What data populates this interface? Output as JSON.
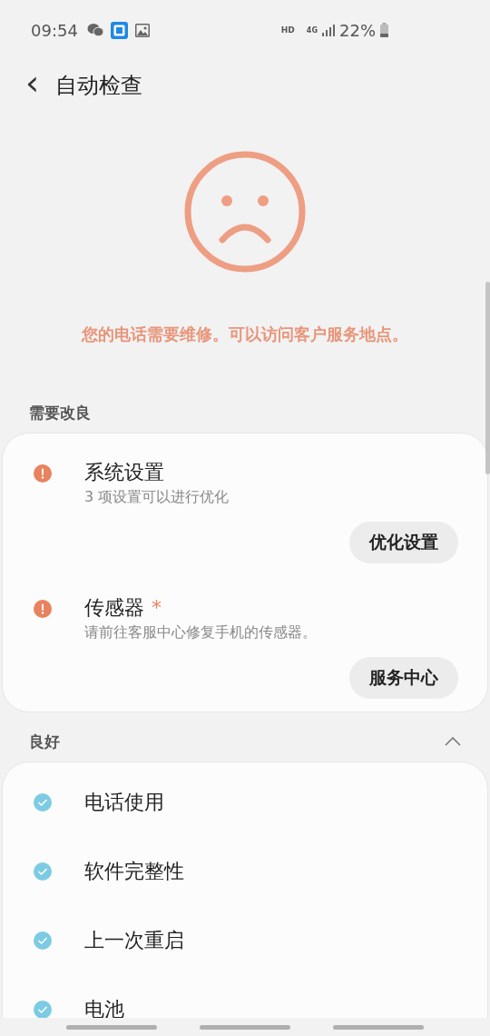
{
  "status_bar": {
    "time": "09:54",
    "hd": "HD",
    "network": "4G",
    "battery": "22%"
  },
  "header": {
    "back": "‹",
    "title": "自动检查"
  },
  "result": {
    "message": "您的电话需要维修。可以访问客户服务地点。"
  },
  "sections": [
    {
      "title": "需要改良",
      "items": [
        {
          "kind": "warning",
          "title": "系统设置",
          "subtitle": "3 项设置可以进行优化",
          "action": "优化设置"
        },
        {
          "kind": "warning",
          "title": "传感器",
          "badge": "*",
          "subtitle": "请前往客服中心修复手机的传感器。",
          "action": "服务中心"
        }
      ]
    },
    {
      "title": "良好",
      "expanded": true,
      "items": [
        {
          "kind": "ok",
          "title": "电话使用"
        },
        {
          "kind": "ok",
          "title": "软件完整性"
        },
        {
          "kind": "ok",
          "title": "上一次重启"
        },
        {
          "kind": "ok",
          "title": "电池"
        }
      ]
    }
  ]
}
